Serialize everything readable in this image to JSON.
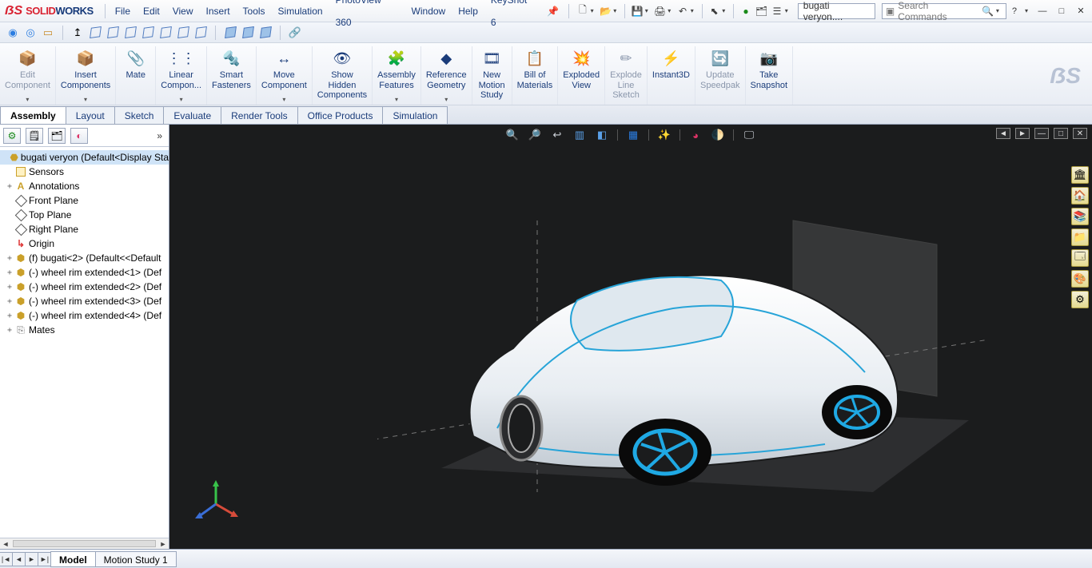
{
  "app": {
    "logo_prefix": "SOLID",
    "logo_suffix": "WORKS"
  },
  "menu": [
    "File",
    "Edit",
    "View",
    "Insert",
    "Tools",
    "Simulation",
    "PhotoView 360",
    "Window",
    "Help",
    "KeyShot 6"
  ],
  "title_filename": "bugati veryon....",
  "search_placeholder": "Search Commands",
  "ribbon": [
    {
      "label": "Edit\nComponent",
      "dd": true,
      "dim": true,
      "icon": "📦"
    },
    {
      "label": "Insert\nComponents",
      "dd": true,
      "icon": "📦"
    },
    {
      "label": "Mate",
      "icon": "📎"
    },
    {
      "label": "Linear\nCompon...",
      "dd": true,
      "icon": "⋮⋮"
    },
    {
      "label": "Smart\nFasteners",
      "icon": "🔩"
    },
    {
      "label": "Move\nComponent",
      "dd": true,
      "icon": "↔"
    },
    {
      "label": "Show\nHidden\nComponents",
      "icon": "👁"
    },
    {
      "label": "Assembly\nFeatures",
      "dd": true,
      "icon": "🧩"
    },
    {
      "label": "Reference\nGeometry",
      "dd": true,
      "icon": "◆"
    },
    {
      "label": "New\nMotion\nStudy",
      "icon": "🎞"
    },
    {
      "label": "Bill of\nMaterials",
      "icon": "📋"
    },
    {
      "label": "Exploded\nView",
      "icon": "💥"
    },
    {
      "label": "Explode\nLine\nSketch",
      "dim": true,
      "icon": "✏"
    },
    {
      "label": "Instant3D",
      "icon": "⚡"
    },
    {
      "label": "Update\nSpeedpak",
      "dim": true,
      "icon": "🔄"
    },
    {
      "label": "Take\nSnapshot",
      "icon": "📷"
    }
  ],
  "ribbon_tabs": [
    "Assembly",
    "Layout",
    "Sketch",
    "Evaluate",
    "Render Tools",
    "Office Products",
    "Simulation"
  ],
  "ribbon_tab_active": 0,
  "tree": {
    "root": "bugati veryon  (Default<Display Sta",
    "items": [
      {
        "icon": "sensor",
        "label": "Sensors",
        "tw": ""
      },
      {
        "icon": "ann",
        "label": "Annotations",
        "tw": "+"
      },
      {
        "icon": "plane",
        "label": "Front Plane",
        "tw": ""
      },
      {
        "icon": "plane",
        "label": "Top Plane",
        "tw": ""
      },
      {
        "icon": "plane",
        "label": "Right Plane",
        "tw": ""
      },
      {
        "icon": "origin",
        "label": "Origin",
        "tw": ""
      },
      {
        "icon": "part",
        "label": "(f) bugati<2> (Default<<Default",
        "tw": "+"
      },
      {
        "icon": "part",
        "label": "(-) wheel rim extended<1> (Def",
        "tw": "+"
      },
      {
        "icon": "part",
        "label": "(-) wheel rim extended<2> (Def",
        "tw": "+"
      },
      {
        "icon": "part",
        "label": "(-) wheel rim extended<3> (Def",
        "tw": "+"
      },
      {
        "icon": "part",
        "label": "(-) wheel rim extended<4> (Def",
        "tw": "+"
      },
      {
        "icon": "mate",
        "label": "Mates",
        "tw": "+"
      }
    ]
  },
  "bottom_tabs": [
    "Model",
    "Motion Study 1"
  ],
  "bottom_tab_active": 0
}
